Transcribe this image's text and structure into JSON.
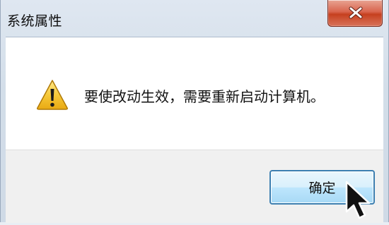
{
  "window": {
    "title": "系统属性"
  },
  "titlebar": {
    "close_icon": "close-icon"
  },
  "dialog": {
    "icon": "warning-icon",
    "message": "要使改动生效，需要重新启动计算机。"
  },
  "buttons": {
    "ok_label": "确定"
  },
  "colors": {
    "close_button": "#c6401f",
    "ok_button_border": "#3c7fb1",
    "warning_yellow": "#f2c12e"
  }
}
